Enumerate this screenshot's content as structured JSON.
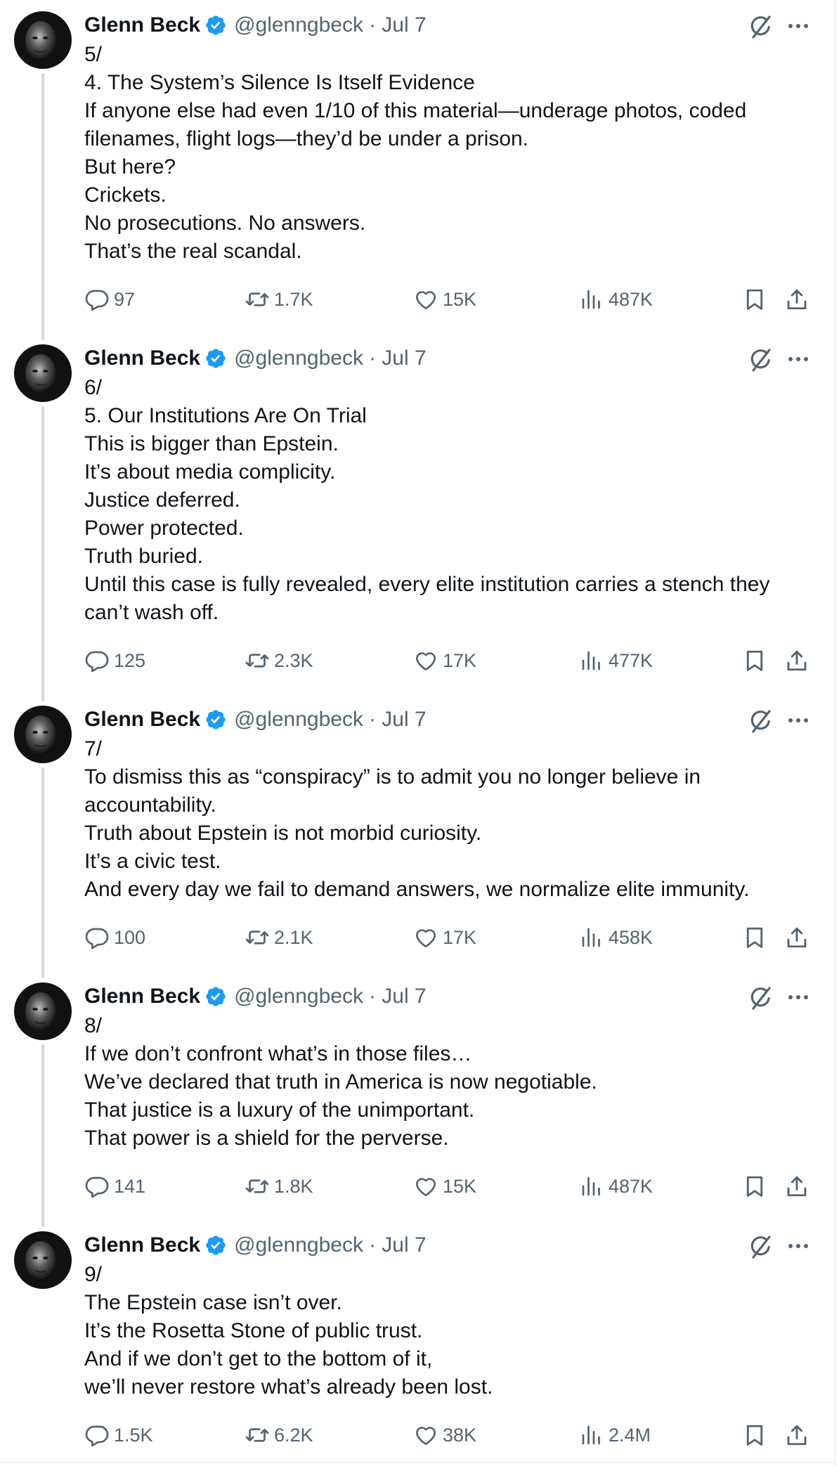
{
  "colors": {
    "text": "#0f1419",
    "secondary": "#536471",
    "verified": "#1d9bf0",
    "thread_line": "#cfd9de"
  },
  "icons": {
    "verified": "verified-badge-icon",
    "grok": "grok-icon",
    "more": "more-icon",
    "reply": "reply-icon",
    "retweet": "retweet-icon",
    "like": "like-icon",
    "views": "views-icon",
    "bookmark": "bookmark-icon",
    "share": "share-icon"
  },
  "tweets": [
    {
      "author": "Glenn Beck",
      "handle": "@glenngbeck",
      "date": "· Jul 7",
      "lines": [
        "5/",
        "4. The System’s Silence Is Itself Evidence",
        "If anyone else had even 1/10 of this material—underage photos, coded",
        "filenames, flight logs—they’d be under a prison.",
        "But here?",
        "Crickets.",
        "No prosecutions. No answers.",
        "That’s the real scandal."
      ],
      "replies": "97",
      "retweets": "1.7K",
      "likes": "15K",
      "views": "487K"
    },
    {
      "author": "Glenn Beck",
      "handle": "@glenngbeck",
      "date": "· Jul 7",
      "lines": [
        "6/",
        "5. Our Institutions Are On Trial",
        "This is bigger than Epstein.",
        "It’s about media complicity.",
        "Justice deferred.",
        "Power protected.",
        "Truth buried.",
        "Until this case is fully revealed, every elite institution carries a stench they",
        "can’t wash off."
      ],
      "replies": "125",
      "retweets": "2.3K",
      "likes": "17K",
      "views": "477K"
    },
    {
      "author": "Glenn Beck",
      "handle": "@glenngbeck",
      "date": "· Jul 7",
      "lines": [
        "7/",
        "To dismiss this as “conspiracy” is to admit you no longer believe in",
        "accountability.",
        "Truth about Epstein is not morbid curiosity.",
        "It’s a civic test.",
        "And every day we fail to demand answers, we normalize elite immunity."
      ],
      "replies": "100",
      "retweets": "2.1K",
      "likes": "17K",
      "views": "458K"
    },
    {
      "author": "Glenn Beck",
      "handle": "@glenngbeck",
      "date": "· Jul 7",
      "lines": [
        "8/",
        "If we don’t confront what’s in those files…",
        "We’ve declared that truth in America is now negotiable.",
        "That justice is a luxury of the unimportant.",
        "That power is a shield for the perverse."
      ],
      "replies": "141",
      "retweets": "1.8K",
      "likes": "15K",
      "views": "487K"
    },
    {
      "author": "Glenn Beck",
      "handle": "@glenngbeck",
      "date": "· Jul 7",
      "lines": [
        "9/",
        "The Epstein case isn’t over.",
        "It’s the Rosetta Stone of public trust.",
        "And if we don’t get to the bottom of it,",
        "we’ll never restore what’s already been lost."
      ],
      "replies": "1.5K",
      "retweets": "6.2K",
      "likes": "38K",
      "views": "2.4M"
    }
  ]
}
